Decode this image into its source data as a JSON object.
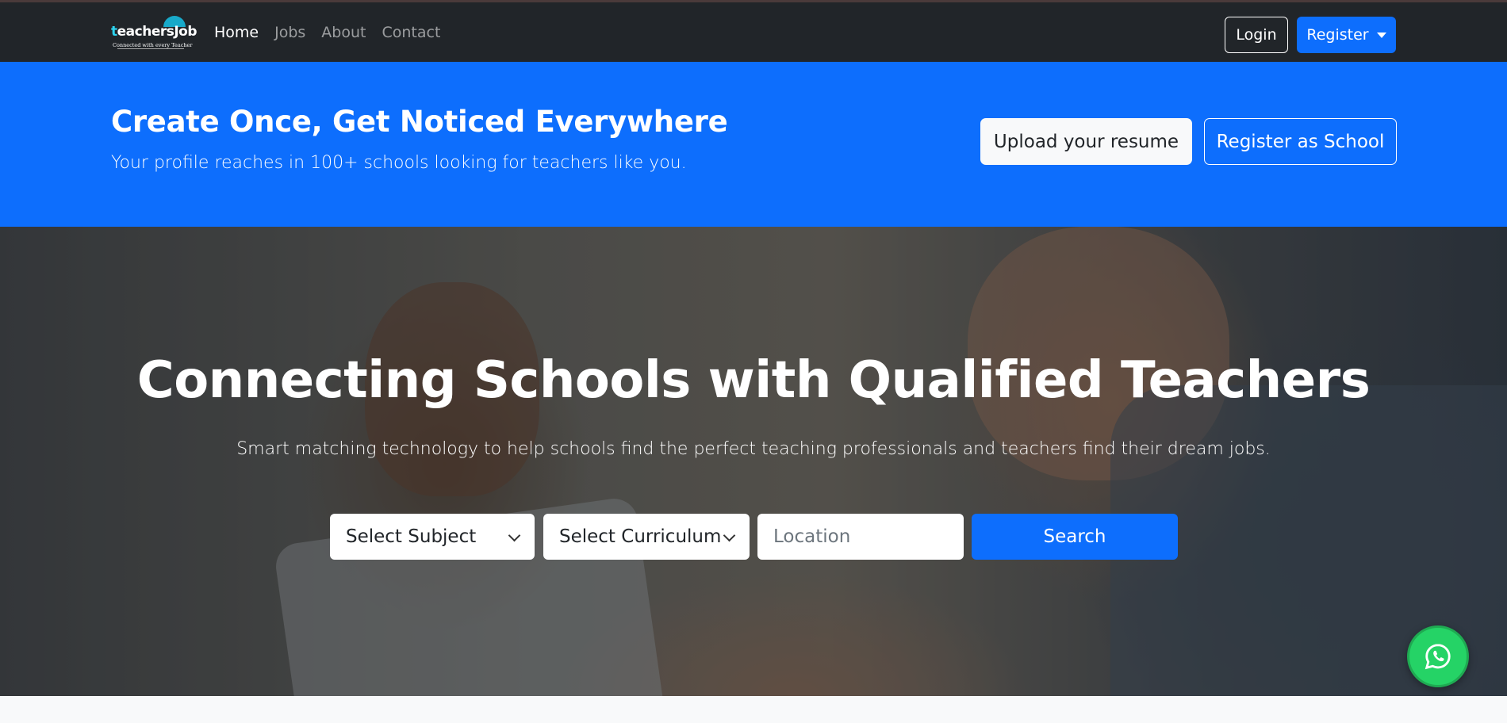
{
  "navbar": {
    "logo_word_t": "t",
    "logo_word_rest": "eachersJob",
    "logo_tagline": "Connected with every Teacher",
    "links": [
      {
        "label": "Home",
        "active": true
      },
      {
        "label": "Jobs",
        "active": false
      },
      {
        "label": "About",
        "active": false
      },
      {
        "label": "Contact",
        "active": false
      }
    ],
    "login_label": "Login",
    "register_label": "Register"
  },
  "banner": {
    "title": "Create Once, Get Noticed Everywhere",
    "subtitle": "Your profile reaches in 100+ schools looking for teachers like you.",
    "upload_label": "Upload your resume",
    "school_label": "Register as School"
  },
  "hero": {
    "title": "Connecting Schools with Qualified Teachers",
    "subtitle": "Smart matching technology to help schools find the perfect teaching professionals and teachers find their dream jobs.",
    "subject_select": "Select Subject",
    "curriculum_select": "Select Curriculum",
    "location_placeholder": "Location",
    "search_label": "Search"
  },
  "colors": {
    "navbar_bg": "#212529",
    "primary": "#0d6efd",
    "whatsapp": "#25d366"
  },
  "icons": {
    "whatsapp": "whatsapp-icon",
    "register_caret": "caret-down-icon",
    "select_chevron": "chevron-down-icon"
  }
}
